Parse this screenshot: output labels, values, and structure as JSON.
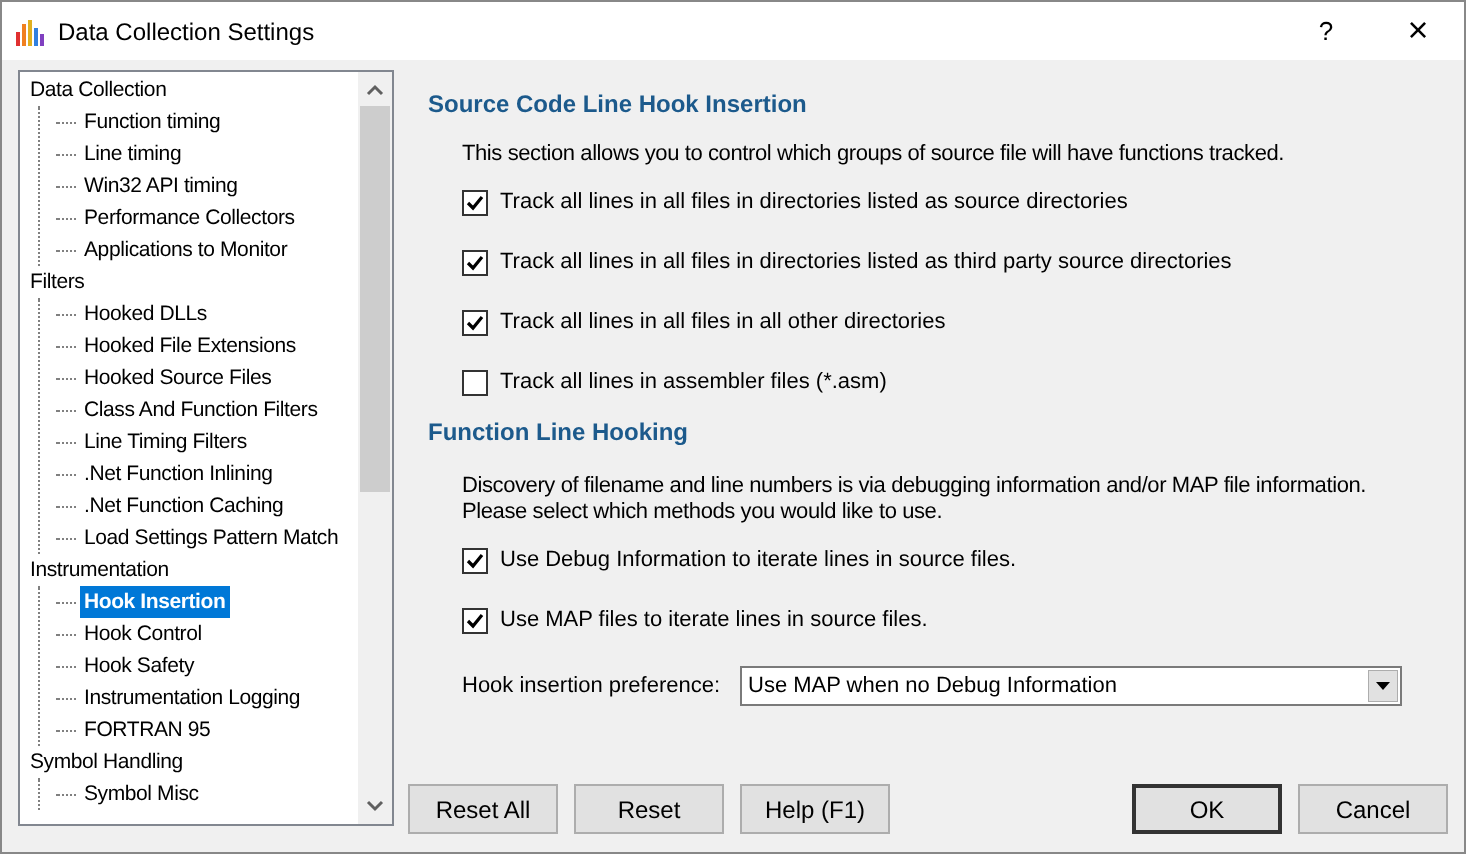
{
  "window": {
    "title": "Data Collection Settings",
    "help": "?",
    "close": "×"
  },
  "tree": [
    {
      "label": "Data Collection",
      "selected": false,
      "children": [
        {
          "label": "Function timing",
          "selected": false
        },
        {
          "label": "Line timing",
          "selected": false
        },
        {
          "label": "Win32 API timing",
          "selected": false
        },
        {
          "label": "Performance Collectors",
          "selected": false
        },
        {
          "label": "Applications to Monitor",
          "selected": false
        }
      ]
    },
    {
      "label": "Filters",
      "selected": false,
      "children": [
        {
          "label": "Hooked DLLs",
          "selected": false
        },
        {
          "label": "Hooked File Extensions",
          "selected": false
        },
        {
          "label": "Hooked Source Files",
          "selected": false
        },
        {
          "label": "Class And Function Filters",
          "selected": false
        },
        {
          "label": "Line Timing Filters",
          "selected": false
        },
        {
          "label": ".Net Function Inlining",
          "selected": false
        },
        {
          "label": ".Net Function Caching",
          "selected": false
        },
        {
          "label": "Load Settings Pattern Match",
          "selected": false
        }
      ]
    },
    {
      "label": "Instrumentation",
      "selected": false,
      "children": [
        {
          "label": "Hook Insertion",
          "selected": true
        },
        {
          "label": "Hook Control",
          "selected": false
        },
        {
          "label": "Hook Safety",
          "selected": false
        },
        {
          "label": "Instrumentation Logging",
          "selected": false
        },
        {
          "label": "FORTRAN 95",
          "selected": false
        }
      ]
    },
    {
      "label": "Symbol Handling",
      "selected": false,
      "children": [
        {
          "label": "Symbol Misc",
          "selected": false
        }
      ]
    }
  ],
  "sections": [
    {
      "heading": "Source Code Line Hook Insertion",
      "description": [
        "This section allows you to control which groups of source file will have functions tracked."
      ],
      "checkboxes": [
        {
          "label": "Track all lines in all files in directories listed as source directories",
          "checked": true
        },
        {
          "label": "Track all lines in all files in directories listed as third party source directories",
          "checked": true
        },
        {
          "label": "Track all lines in all files in all other directories",
          "checked": true
        },
        {
          "label": "Track all lines in assembler files (*.asm)",
          "checked": false
        }
      ]
    },
    {
      "heading": "Function Line Hooking",
      "description": [
        "Discovery of filename and line numbers is via debugging information and/or MAP file information.",
        "Please select which methods you would like to use."
      ],
      "checkboxes": [
        {
          "label": "Use Debug Information to iterate lines in source files.",
          "checked": true
        },
        {
          "label": "Use MAP files to iterate lines in source files.",
          "checked": true
        }
      ],
      "dropdown": {
        "label": "Hook insertion preference:",
        "value": "Use MAP when no Debug Information"
      }
    }
  ],
  "buttons_left": [
    "Reset All",
    "Reset",
    "Help (F1)"
  ],
  "buttons_right": [
    {
      "label": "OK",
      "default": true
    },
    {
      "label": "Cancel",
      "default": false
    }
  ]
}
